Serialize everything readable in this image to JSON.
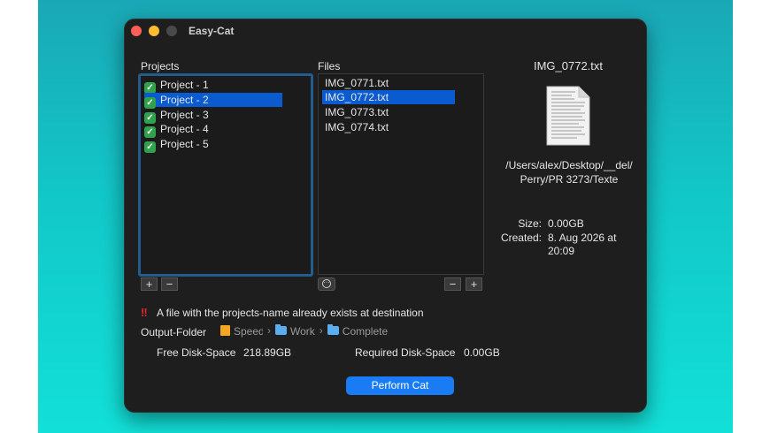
{
  "window": {
    "title": "Easy-Cat"
  },
  "projects": {
    "label": "Projects",
    "items": [
      {
        "label": "Project - 1",
        "checked": true,
        "selected": false
      },
      {
        "label": "Project - 2",
        "checked": true,
        "selected": true
      },
      {
        "label": "Project - 3",
        "checked": true,
        "selected": false
      },
      {
        "label": "Project - 4",
        "checked": true,
        "selected": false
      },
      {
        "label": "Project - 5",
        "checked": true,
        "selected": false
      }
    ],
    "add": "+",
    "remove": "−"
  },
  "files": {
    "label": "Files",
    "items": [
      {
        "label": "IMG_0771.txt",
        "selected": false
      },
      {
        "label": "IMG_0772.txt",
        "selected": true
      },
      {
        "label": "IMG_0773.txt",
        "selected": false
      },
      {
        "label": "IMG_0774.txt",
        "selected": false
      }
    ],
    "add": "+",
    "remove": "−"
  },
  "preview": {
    "filename": "IMG_0772.txt",
    "path_line1": "/Users/alex/Desktop/__del/",
    "path_line2": "Perry/PR 3273/Texte",
    "size_label": "Size:",
    "size_value": "0.00GB",
    "created_label": "Created:",
    "created_value_line1": "8. Aug 2026 at",
    "created_value_line2": "20:09"
  },
  "warning": {
    "icon": "double-exclamation-icon",
    "text": "A file with the projects-name already exists at destination"
  },
  "output": {
    "label": "Output-Folder",
    "path": [
      "Speed",
      "Work",
      "Complete"
    ],
    "separator": "›"
  },
  "disk": {
    "free_label": "Free Disk-Space",
    "free_value": "218.89GB",
    "required_label": "Required Disk-Space",
    "required_value": "0.00GB"
  },
  "actions": {
    "perform": "Perform Cat"
  },
  "colors": {
    "accent": "#1a7cf5",
    "selection": "#0a5bd0",
    "check": "#31a24c",
    "warning": "#e0262a"
  }
}
